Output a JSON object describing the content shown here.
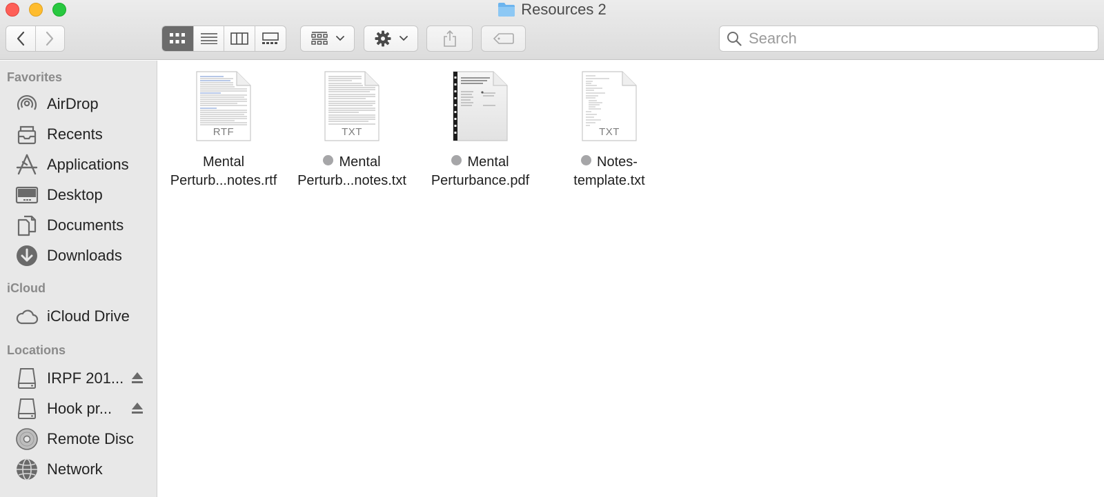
{
  "window": {
    "title": "Resources 2"
  },
  "toolbar": {
    "search_placeholder": "Search",
    "view_modes": [
      "icon",
      "list",
      "column",
      "gallery"
    ],
    "active_view": "icon"
  },
  "sidebar": {
    "favorites_header": "Favorites",
    "favorites": [
      {
        "label": "AirDrop",
        "icon": "airdrop-icon"
      },
      {
        "label": "Recents",
        "icon": "recents-icon"
      },
      {
        "label": "Applications",
        "icon": "applications-icon"
      },
      {
        "label": "Desktop",
        "icon": "desktop-icon"
      },
      {
        "label": "Documents",
        "icon": "documents-icon"
      },
      {
        "label": "Downloads",
        "icon": "downloads-icon"
      }
    ],
    "icloud_header": "iCloud",
    "icloud": [
      {
        "label": "iCloud Drive",
        "icon": "icloud-icon"
      }
    ],
    "locations_header": "Locations",
    "locations": [
      {
        "label": "IRPF 201...",
        "icon": "disk-icon",
        "ejectable": true
      },
      {
        "label": "Hook pr...",
        "icon": "disk-icon",
        "ejectable": true
      },
      {
        "label": "Remote Disc",
        "icon": "remote-disc-icon",
        "ejectable": false
      },
      {
        "label": "Network",
        "icon": "network-icon",
        "ejectable": false
      }
    ]
  },
  "files": [
    {
      "line1": "Mental",
      "line2": "Perturb...notes.rtf",
      "ext": "RTF",
      "tagged": false
    },
    {
      "line1": "Mental",
      "line2": "Perturb...notes.txt",
      "ext": "TXT",
      "tagged": true
    },
    {
      "line1": "Mental",
      "line2": "Perturbance.pdf",
      "ext": "",
      "tagged": true
    },
    {
      "line1": "Notes-",
      "line2": "template.txt",
      "ext": "TXT",
      "tagged": true
    }
  ],
  "colors": {
    "tag_gray": "#a6a6a8",
    "close": "#fe5f57",
    "minimize": "#febc2e",
    "zoom": "#28c840",
    "folder_blue": "#6cb4ee"
  }
}
